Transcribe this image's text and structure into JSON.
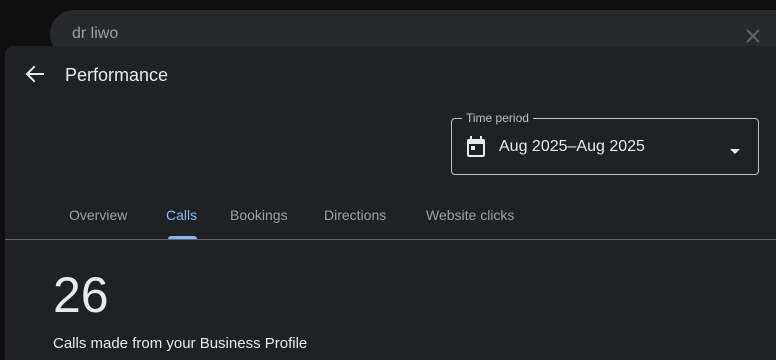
{
  "search": {
    "query": "dr liwo"
  },
  "header": {
    "title": "Performance",
    "back_icon": "arrow-left-icon"
  },
  "time_period": {
    "label": "Time period",
    "value": "Aug 2025–Aug 2025",
    "icon": "calendar-icon"
  },
  "tabs": [
    {
      "label": "Overview",
      "active": false
    },
    {
      "label": "Calls",
      "active": true
    },
    {
      "label": "Bookings",
      "active": false
    },
    {
      "label": "Directions",
      "active": false
    },
    {
      "label": "Website clicks",
      "active": false
    }
  ],
  "metric": {
    "value": "26",
    "caption": "Calls made from your Business Profile"
  },
  "colors": {
    "accent": "#8ab4f8",
    "panel_bg": "#202124",
    "page_bg": "#0f0f10",
    "text_primary": "#e8eaed",
    "text_secondary": "#9aa0a6"
  }
}
